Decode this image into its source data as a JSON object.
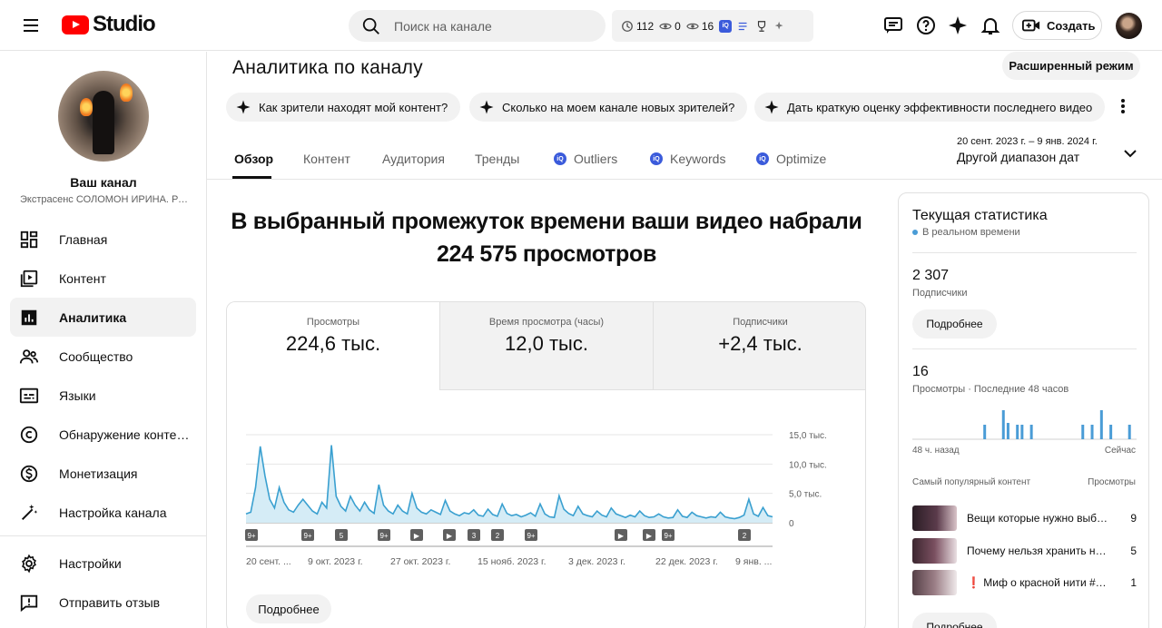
{
  "header": {
    "logo_text": "Studio",
    "search_placeholder": "Поиск на канале",
    "ext_stats": [
      {
        "icon": "clock-icon",
        "value": "112"
      },
      {
        "icon": "eye-icon",
        "value": "0"
      },
      {
        "icon": "eye-icon",
        "value": "16"
      }
    ],
    "create_label": "Создать"
  },
  "sidebar": {
    "channel_title": "Ваш канал",
    "channel_name": "Экстрасенс СОЛОМОН ИРИНА. Ра...",
    "items": [
      {
        "label": "Главная",
        "icon": "dashboard-icon"
      },
      {
        "label": "Контент",
        "icon": "content-icon"
      },
      {
        "label": "Аналитика",
        "icon": "analytics-icon",
        "active": true
      },
      {
        "label": "Сообщество",
        "icon": "community-icon"
      },
      {
        "label": "Языки",
        "icon": "subtitles-icon"
      },
      {
        "label": "Обнаружение контента",
        "icon": "copyright-icon"
      },
      {
        "label": "Монетизация",
        "icon": "dollar-icon"
      },
      {
        "label": "Настройка канала",
        "icon": "magic-wand-icon"
      }
    ],
    "bottom_items": [
      {
        "label": "Настройки",
        "icon": "gear-icon"
      },
      {
        "label": "Отправить отзыв",
        "icon": "feedback-icon"
      }
    ]
  },
  "main": {
    "title": "Аналитика по каналу",
    "advanced_label": "Расширенный режим",
    "chips": [
      "Как зрители находят мой контент?",
      "Сколько на моем канале новых зрителей?",
      "Дать краткую оценку эффективности последнего видео"
    ],
    "tabs": [
      {
        "label": "Обзор",
        "active": true
      },
      {
        "label": "Контент"
      },
      {
        "label": "Аудитория"
      },
      {
        "label": "Тренды"
      },
      {
        "label": "Outliers",
        "ext": true
      },
      {
        "label": "Keywords",
        "ext": true
      },
      {
        "label": "Optimize",
        "ext": true
      }
    ],
    "date_range_small": "20 сент. 2023 г. – 9 янв. 2024 г.",
    "date_range_label": "Другой диапазон дат",
    "headline_line1": "В выбранный промежуток времени ваши видео набрали",
    "headline_line2": "224 575 просмотров",
    "metrics": [
      {
        "label": "Просмотры",
        "value": "224,6 тыс."
      },
      {
        "label": "Время просмотра (часы)",
        "value": "12,0 тыс."
      },
      {
        "label": "Подписчики",
        "value": "+2,4 тыс."
      }
    ],
    "more_label": "Подробнее"
  },
  "chart_data": {
    "type": "line",
    "title": "",
    "xlabel": "",
    "ylabel": "",
    "ylim": [
      0,
      15000
    ],
    "y_ticks": [
      "15,0 тыс.",
      "10,0 тыс.",
      "5,0 тыс.",
      "0"
    ],
    "x_tick_labels": [
      "20 сент. ...",
      "9 окт. 2023 г.",
      "27 окт. 2023 г.",
      "15 нояб. 2023 г.",
      "3 дек. 2023 г.",
      "22 дек. 2023 г.",
      "9 янв. ..."
    ],
    "markers": [
      "9+",
      "9+",
      "5",
      "9+",
      "▶",
      "▶",
      "3",
      "2",
      "9+",
      "▶",
      "▶",
      "9+",
      "2"
    ],
    "x": [
      "2023-09-20",
      "2023-09-21",
      "2023-09-22",
      "2023-09-23",
      "2023-09-24",
      "2023-09-25",
      "2023-09-26",
      "2023-09-27",
      "2023-09-28",
      "2023-09-29",
      "2023-09-30",
      "2023-10-01",
      "2023-10-02",
      "2023-10-03",
      "2023-10-04",
      "2023-10-05",
      "2023-10-06",
      "2023-10-07",
      "2023-10-08",
      "2023-10-09",
      "2023-10-10",
      "2023-10-11",
      "2023-10-12",
      "2023-10-13",
      "2023-10-14",
      "2023-10-15",
      "2023-10-16",
      "2023-10-17",
      "2023-10-18",
      "2023-10-19",
      "2023-10-20",
      "2023-10-21",
      "2023-10-22",
      "2023-10-23",
      "2023-10-24",
      "2023-10-25",
      "2023-10-26",
      "2023-10-27",
      "2023-10-28",
      "2023-10-29",
      "2023-10-30",
      "2023-10-31",
      "2023-11-01",
      "2023-11-02",
      "2023-11-03",
      "2023-11-04",
      "2023-11-05",
      "2023-11-06",
      "2023-11-07",
      "2023-11-08",
      "2023-11-09",
      "2023-11-10",
      "2023-11-11",
      "2023-11-12",
      "2023-11-13",
      "2023-11-14",
      "2023-11-15",
      "2023-11-16",
      "2023-11-17",
      "2023-11-18",
      "2023-11-19",
      "2023-11-20",
      "2023-11-21",
      "2023-11-22",
      "2023-11-23",
      "2023-11-24",
      "2023-11-25",
      "2023-11-26",
      "2023-11-27",
      "2023-11-28",
      "2023-11-29",
      "2023-11-30",
      "2023-12-01",
      "2023-12-02",
      "2023-12-03",
      "2023-12-04",
      "2023-12-05",
      "2023-12-06",
      "2023-12-07",
      "2023-12-08",
      "2023-12-09",
      "2023-12-10",
      "2023-12-11",
      "2023-12-12",
      "2023-12-13",
      "2023-12-14",
      "2023-12-15",
      "2023-12-16",
      "2023-12-17",
      "2023-12-18",
      "2023-12-19",
      "2023-12-20",
      "2023-12-21",
      "2023-12-22",
      "2023-12-23",
      "2023-12-24",
      "2023-12-25",
      "2023-12-26",
      "2023-12-27",
      "2023-12-28",
      "2023-12-29",
      "2023-12-30",
      "2023-12-31",
      "2024-01-01",
      "2024-01-02",
      "2024-01-03",
      "2024-01-04",
      "2024-01-05",
      "2024-01-06",
      "2024-01-07",
      "2024-01-08",
      "2024-01-09"
    ],
    "series": [
      {
        "values": [
          1500,
          1800,
          6000,
          13000,
          8000,
          4000,
          2500,
          6000,
          3500,
          2200,
          1800,
          3000,
          4000,
          3000,
          2000,
          1500,
          3500,
          2500,
          13200,
          4500,
          2800,
          2000,
          4500,
          3000,
          2000,
          3500,
          2200,
          1600,
          6500,
          3000,
          2000,
          1500,
          3000,
          2000,
          1500,
          5000,
          2500,
          1800,
          1500,
          2200,
          1800,
          1400,
          3800,
          2000,
          1500,
          1200,
          1700,
          1500,
          2200,
          1300,
          1100,
          2300,
          1400,
          1100,
          3200,
          1600,
          1200,
          1400,
          1000,
          1300,
          1700,
          1100,
          3200,
          1500,
          1000,
          900,
          4600,
          2300,
          1600,
          1200,
          2800,
          1500,
          1200,
          1000,
          2000,
          1300,
          1000,
          2500,
          1500,
          1200,
          900,
          1300,
          1000,
          2000,
          1200,
          900,
          1000,
          1500,
          1000,
          800,
          900,
          2200,
          1100,
          900,
          1800,
          1200,
          1000,
          800,
          1000,
          900,
          1800,
          1000,
          800,
          700,
          900,
          1300,
          4000,
          1500,
          1100,
          2600,
          1200,
          1000
        ]
      }
    ]
  },
  "right_panel": {
    "title": "Текущая статистика",
    "live_label": "В реальном времени",
    "subscribers_value": "2 307",
    "subscribers_label": "Подписчики",
    "details_label": "Подробнее",
    "views_value": "16",
    "views_label": "Просмотры · Последние 48 часов",
    "axis_left": "48 ч. назад",
    "axis_right": "Сейчас",
    "hourly_bars": [
      0,
      0,
      0,
      0,
      0,
      0,
      0,
      0,
      0,
      0,
      0,
      0,
      0,
      0,
      0,
      1,
      0,
      0,
      0,
      1,
      1,
      0,
      1,
      1,
      0,
      1,
      0,
      0,
      0,
      0,
      0,
      0,
      0,
      0,
      0,
      0,
      1,
      0,
      1,
      0,
      1,
      0,
      1,
      0,
      0,
      0,
      1,
      0
    ],
    "top_header_left": "Самый популярный контент",
    "top_header_right": "Просмотры",
    "top_content": [
      {
        "title": "Вещи которые нужно выбросить из дома",
        "value": "9"
      },
      {
        "title": "Почему нельзя хранить нетронутые вещи",
        "value": "5"
      },
      {
        "title": "❗ Миф о красной нити #красная нить",
        "value": "1"
      }
    ],
    "bottom_details_label": "Подробнее"
  }
}
